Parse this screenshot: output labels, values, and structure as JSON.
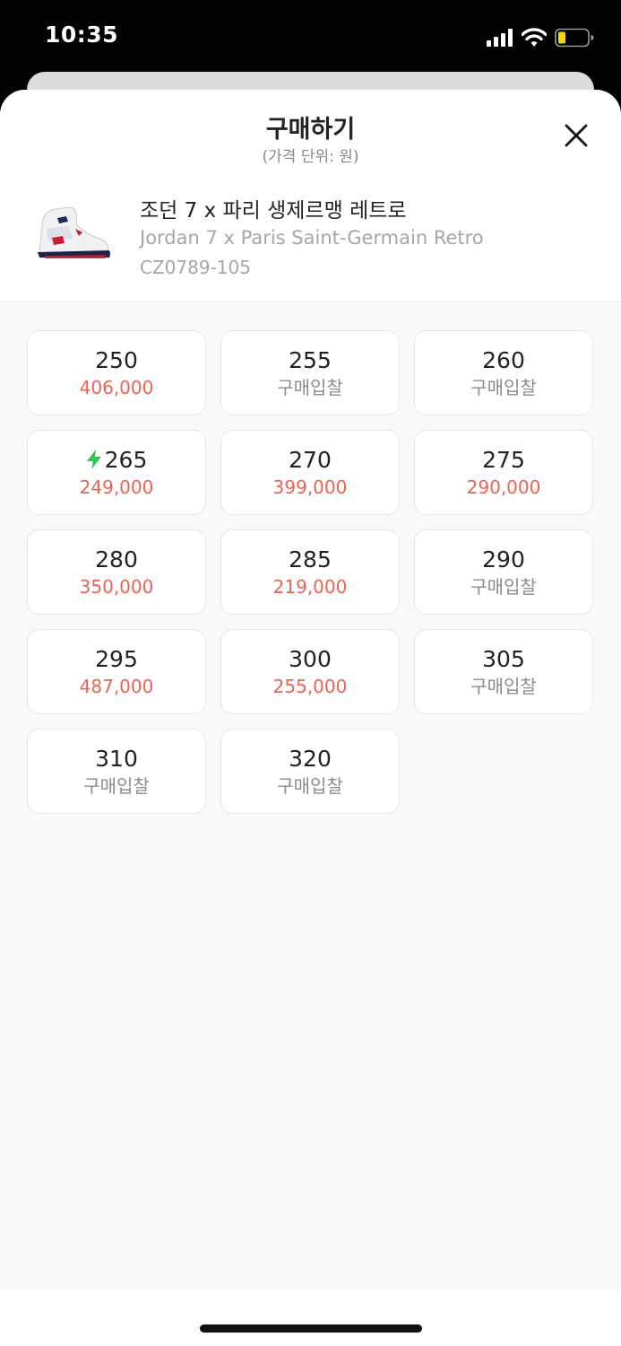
{
  "status_bar": {
    "time": "10:35"
  },
  "sheet": {
    "title": "구매하기",
    "subtitle": "(가격 단위: 원)"
  },
  "product": {
    "name_ko": "조던 7 x 파리 생제르맹 레트로",
    "name_en": "Jordan 7 x Paris Saint-Germain Retro",
    "code": "CZ0789-105"
  },
  "sizes": [
    {
      "size": "250",
      "price": "406,000",
      "bid": false,
      "fast": false
    },
    {
      "size": "255",
      "price": "구매입찰",
      "bid": true,
      "fast": false
    },
    {
      "size": "260",
      "price": "구매입찰",
      "bid": true,
      "fast": false
    },
    {
      "size": "265",
      "price": "249,000",
      "bid": false,
      "fast": true
    },
    {
      "size": "270",
      "price": "399,000",
      "bid": false,
      "fast": false
    },
    {
      "size": "275",
      "price": "290,000",
      "bid": false,
      "fast": false
    },
    {
      "size": "280",
      "price": "350,000",
      "bid": false,
      "fast": false
    },
    {
      "size": "285",
      "price": "219,000",
      "bid": false,
      "fast": false
    },
    {
      "size": "290",
      "price": "구매입찰",
      "bid": true,
      "fast": false
    },
    {
      "size": "295",
      "price": "487,000",
      "bid": false,
      "fast": false
    },
    {
      "size": "300",
      "price": "255,000",
      "bid": false,
      "fast": false
    },
    {
      "size": "305",
      "price": "구매입찰",
      "bid": true,
      "fast": false
    },
    {
      "size": "310",
      "price": "구매입찰",
      "bid": true,
      "fast": false
    },
    {
      "size": "320",
      "price": "구매입찰",
      "bid": true,
      "fast": false
    }
  ],
  "colors": {
    "price_red": "#ef6253",
    "bid_gray": "#8c8c8c",
    "bolt_green": "#2dc653",
    "battery_yellow": "#f5d60b"
  },
  "icons": {
    "close": "close-icon",
    "fast_delivery": "lightning-bolt-icon",
    "signal": "cellular-signal-icon",
    "wifi": "wifi-icon",
    "battery": "battery-icon"
  }
}
